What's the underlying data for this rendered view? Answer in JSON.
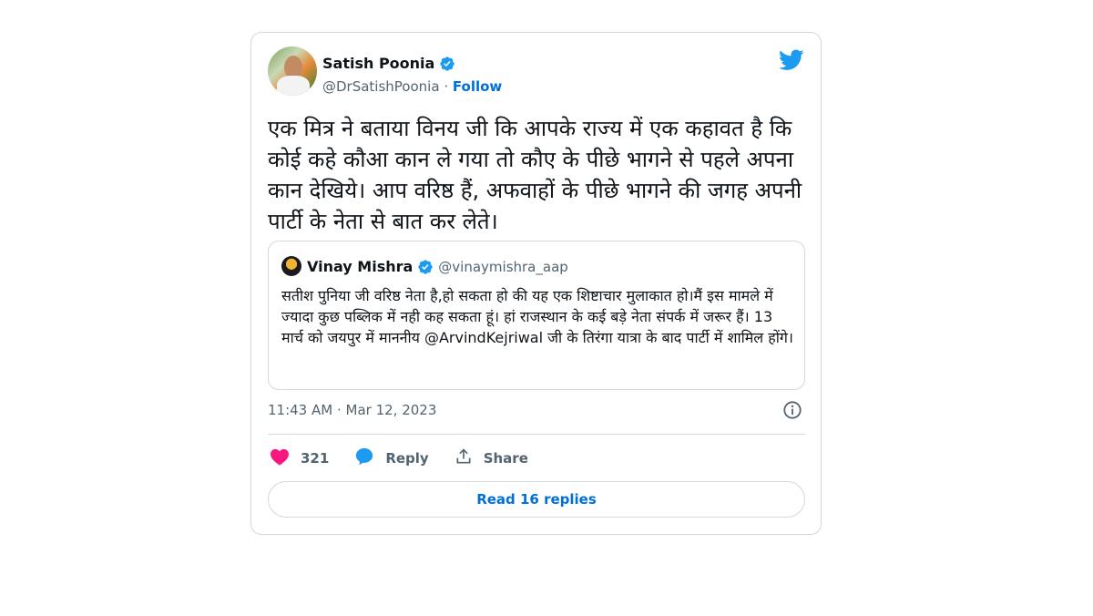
{
  "tweet": {
    "author_name": "Satish Poonia",
    "author_handle": "@DrSatishPoonia",
    "separator": "·",
    "follow_label": "Follow",
    "text": "एक मित्र ने बताया विनय जी कि आपके राज्य में एक कहावत है कि कोई कहे कौआ कान ले गया तो कौए के पीछे भागने से पहले अपना कान देखिये। आप वरिष्ठ हैं, अफवाहों के पीछे भागने की जगह अपनी पार्टी के नेता से बात कर लेते।",
    "timestamp": "11:43 AM · Mar 12, 2023",
    "likes": "321",
    "reply_label": "Reply",
    "share_label": "Share",
    "read_replies_label": "Read 16 replies"
  },
  "quoted": {
    "author_name": "Vinay Mishra",
    "author_handle": "@vinaymishra_aap",
    "text": "सतीश पुनिया जी वरिष्ठ नेता है,हो सकता हो की यह एक शिष्टाचार मुलाकात हो।मैं इस मामले में ज्यादा कुछ पब्लिक में नही कह सकता हूं। हां राजस्थान के कई बड़े नेता संपर्क में जरूर हैं। 13 मार्च को जयपुर में माननीय @ArvindKejriwal जी के तिरंगा यात्रा के बाद पार्टी में शामिल होंगे।"
  },
  "icons": {
    "verified": "verified-badge-icon",
    "brand": "twitter-bird-icon",
    "info": "info-icon",
    "like": "heart-icon",
    "reply": "speech-bubble-icon",
    "share": "share-upload-icon"
  },
  "colors": {
    "twitter_blue": "#1d9bf0",
    "link_blue": "#006fd6",
    "like_pink": "#f91880",
    "muted_text": "#536471",
    "border": "#cfd9de"
  }
}
